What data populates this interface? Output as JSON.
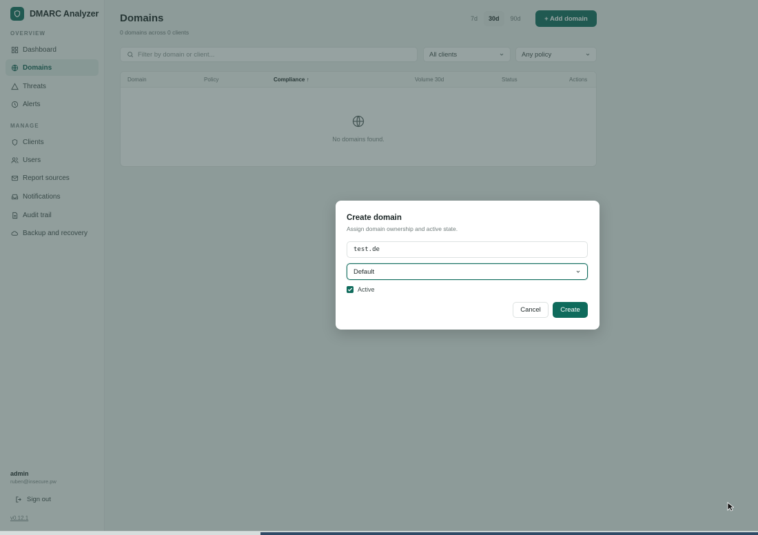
{
  "sidebar": {
    "brand": "DMARC Analyzer",
    "section_overview": "OVERVIEW",
    "section_manage": "MANAGE",
    "overview_items": [
      {
        "label": "Dashboard"
      },
      {
        "label": "Domains"
      },
      {
        "label": "Threats"
      },
      {
        "label": "Alerts"
      }
    ],
    "manage_items": [
      {
        "label": "Clients"
      },
      {
        "label": "Users"
      },
      {
        "label": "Report sources"
      },
      {
        "label": "Notifications"
      },
      {
        "label": "Audit trail"
      },
      {
        "label": "Backup and recovery"
      }
    ],
    "user_name": "admin",
    "user_email": "ruben@insecure.pw",
    "sign_out": "Sign out",
    "version": "v0.12.1"
  },
  "header": {
    "title": "Domains",
    "subtitle": "0 domains across 0 clients",
    "ranges": [
      "7d",
      "30d",
      "90d"
    ],
    "active_range": "30d",
    "add_button": "+ Add domain"
  },
  "filters": {
    "search_placeholder": "Filter by domain or client...",
    "client_select": "All clients",
    "policy_select": "Any policy"
  },
  "table": {
    "columns": [
      "Domain",
      "Policy",
      "Compliance ↑",
      "Volume 30d",
      "Status",
      "Actions"
    ],
    "empty_text": "No domains found."
  },
  "modal": {
    "title": "Create domain",
    "description": "Assign domain ownership and active state.",
    "domain_value": "test.de",
    "client_value": "Default",
    "active_label": "Active",
    "active_checked": true,
    "cancel_label": "Cancel",
    "create_label": "Create"
  },
  "colors": {
    "accent": "#0f6b5c",
    "overlay": "#324846"
  },
  "icons": {
    "brand": "shield-icon",
    "dashboard": "grid-icon",
    "domains": "globe-icon",
    "threats": "warning-icon",
    "alerts": "clock-icon",
    "clients": "shield-icon",
    "users": "users-icon",
    "report_sources": "mail-icon",
    "notifications": "inbox-icon",
    "audit_trail": "document-icon",
    "backup": "cloud-icon"
  }
}
